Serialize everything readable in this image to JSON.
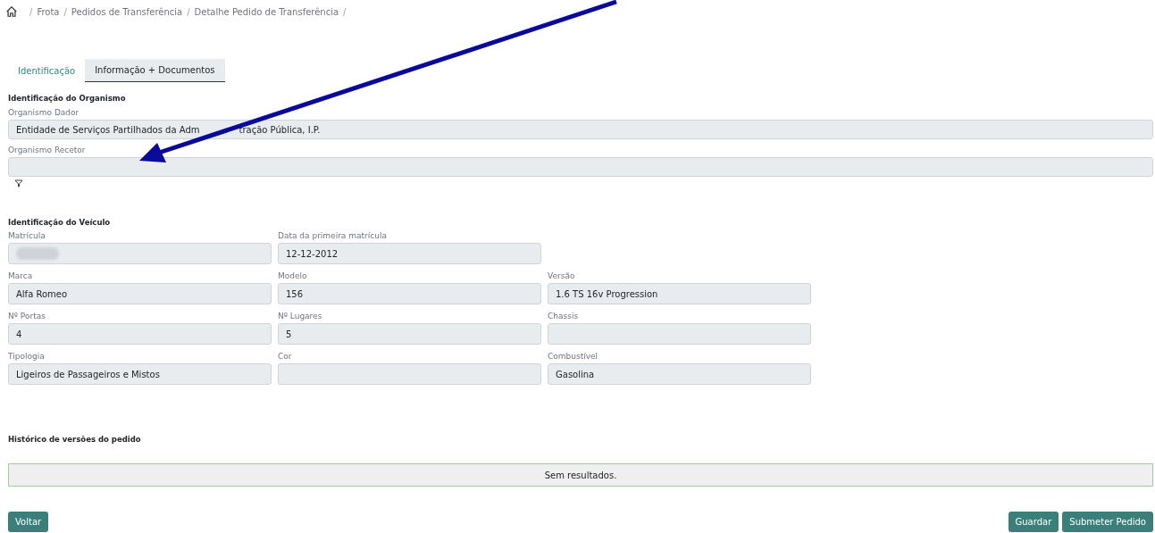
{
  "breadcrumb": [
    {
      "kind": "separator",
      "text": "/"
    },
    {
      "kind": "link",
      "text": "Frota"
    },
    {
      "kind": "separator",
      "text": "/"
    },
    {
      "kind": "link",
      "text": "Pedidos de Transferência"
    },
    {
      "kind": "separator",
      "text": "/"
    },
    {
      "kind": "link",
      "text": "Detalhe Pedido de Transferência"
    },
    {
      "kind": "separator",
      "text": "/"
    }
  ],
  "tabs": [
    {
      "label": "Identificação",
      "selected": false
    },
    {
      "label": "Informação + Documentos",
      "selected": true
    }
  ],
  "organismo": {
    "title": "Identificação do Organismo",
    "fields": [
      {
        "label": "Organismo Dador",
        "value_parts": [
          "Entidade de Serviços Partilhados da Adm",
          "tração Pública, I.P."
        ]
      },
      {
        "label": "Organismo Recetor",
        "filter": true
      }
    ]
  },
  "veiculo": {
    "title": "Identificação do Veículo",
    "rows": [
      [
        {
          "label": "Matrícula",
          "redacted": true
        },
        {
          "label": "Data da primeira matrícula",
          "value": "12-12-2012"
        }
      ],
      [
        {
          "label": "Marca",
          "value": "Alfa Romeo"
        },
        {
          "label": "Modelo",
          "value": "156"
        },
        {
          "label": "Versão",
          "value": "1.6 TS 16v Progression"
        }
      ],
      [
        {
          "label": "Nº Portas",
          "value": "4"
        },
        {
          "label": "Nº Lugares",
          "value": "5"
        },
        {
          "label": "Chassis"
        }
      ],
      [
        {
          "label": "Tipologia",
          "value": "Ligeiros de Passageiros e Mistos"
        },
        {
          "label": "Cor"
        },
        {
          "label": "Combustível",
          "value": "Gasolina"
        }
      ]
    ]
  },
  "historico": {
    "title": "Histórico de versões do pedido",
    "empty_text": "Sem resultados."
  },
  "buttons": {
    "left": [
      "Voltar"
    ],
    "right": [
      "Guardar",
      "Submeter Pedido"
    ]
  },
  "annotation": {
    "kind": "arrow"
  }
}
